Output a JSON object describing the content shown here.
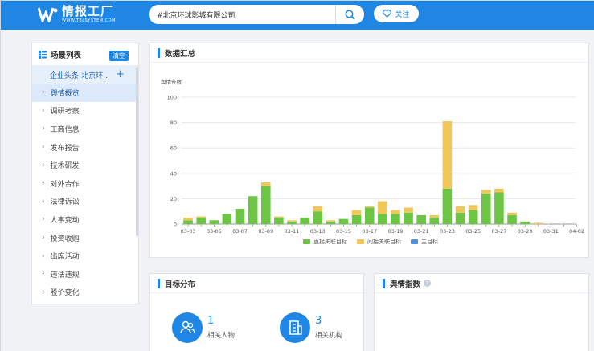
{
  "header": {
    "logo_text": "情报工厂",
    "logo_subtext": "WWW.TBLSYSTEM.COM",
    "search_value": "#北京环球影城有限公司",
    "follow_label": "关注"
  },
  "sidebar": {
    "title": "场景列表",
    "clear_label": "清空",
    "scene": "企业头条-北京环...",
    "items": [
      "舆情概览",
      "调研考察",
      "工商信息",
      "发布报告",
      "技术研发",
      "对外合作",
      "法律诉讼",
      "人事变动",
      "投资收购",
      "出席活动",
      "违法违规",
      "股价变化"
    ],
    "active_index": 0
  },
  "summary_panel": {
    "title": "数据汇总"
  },
  "target_panel": {
    "title": "目标分布",
    "stats": [
      {
        "value": "1",
        "label": "相关人物",
        "icon": "people-icon"
      },
      {
        "value": "3",
        "label": "相关机构",
        "icon": "building-icon"
      }
    ]
  },
  "sentiment_panel": {
    "title": "舆情指数",
    "help": "?"
  },
  "chart_data": {
    "type": "bar",
    "stacked": true,
    "ylabel": "舆情条数",
    "ylim": [
      0,
      100
    ],
    "yticks": [
      0,
      20,
      40,
      60,
      80,
      100
    ],
    "categories": [
      "03-03",
      "03-04",
      "03-05",
      "03-06",
      "03-07",
      "03-08",
      "03-09",
      "03-10",
      "03-11",
      "03-12",
      "03-13",
      "03-14",
      "03-15",
      "03-16",
      "03-17",
      "03-18",
      "03-19",
      "03-20",
      "03-21",
      "03-22",
      "03-23",
      "03-24",
      "03-25",
      "03-26",
      "03-27",
      "03-28",
      "03-29",
      "03-30",
      "03-31",
      "04-01",
      "04-02"
    ],
    "xtick_labels": [
      "03-03",
      "03-05",
      "03-07",
      "03-09",
      "03-11",
      "03-13",
      "03-15",
      "03-17",
      "03-19",
      "03-21",
      "03-23",
      "03-25",
      "03-27",
      "03-29",
      "03-31",
      "04-02"
    ],
    "series": [
      {
        "name": "直接关联目标",
        "color": "#6cc644",
        "values": [
          3,
          5,
          3,
          8,
          12,
          22,
          30,
          5,
          2,
          5,
          10,
          2,
          4,
          7,
          13,
          8,
          8,
          9,
          7,
          5,
          28,
          9,
          11,
          24,
          25,
          7,
          2,
          0,
          0,
          0,
          0
        ]
      },
      {
        "name": "间接关联目标",
        "color": "#f0c75a",
        "values": [
          2,
          1,
          0,
          0,
          0,
          0,
          3,
          1,
          1,
          0,
          4,
          1,
          0,
          4,
          1,
          10,
          3,
          4,
          0,
          2,
          53,
          5,
          4,
          3,
          3,
          2,
          0,
          1,
          0,
          0,
          0
        ]
      },
      {
        "name": "主目标",
        "color": "#4a90e2",
        "values": [
          0,
          0,
          0,
          0,
          0,
          0,
          0,
          0,
          0,
          0,
          0,
          0,
          0,
          0,
          0,
          0,
          0,
          0,
          0,
          0,
          0,
          0,
          0,
          0,
          0,
          0,
          0,
          0,
          0,
          0,
          0
        ]
      }
    ],
    "grid": true,
    "legend_position": "bottom"
  }
}
